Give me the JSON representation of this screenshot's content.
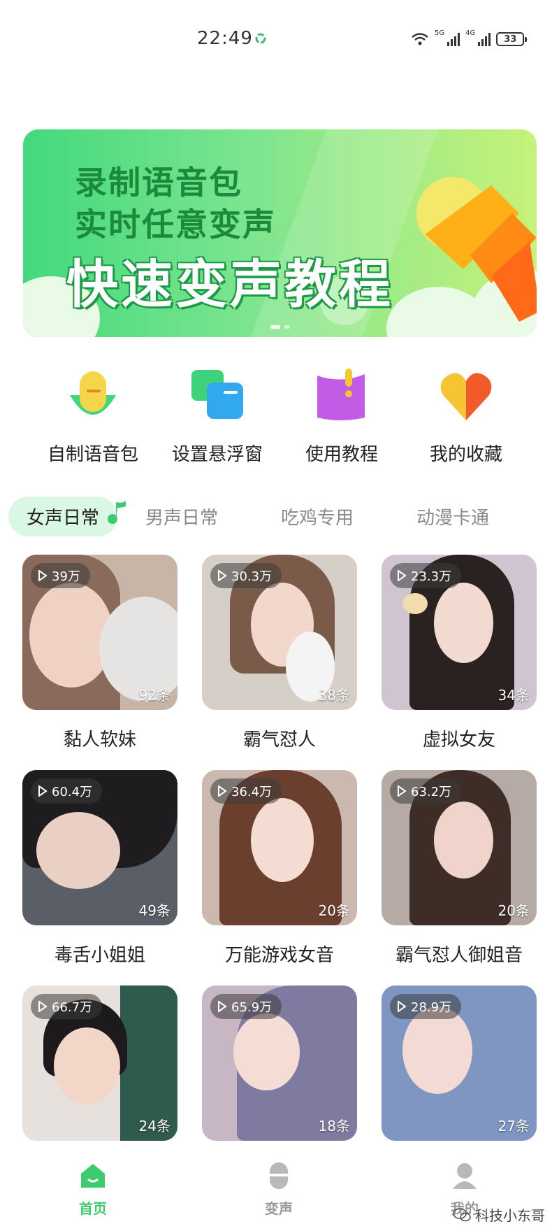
{
  "status_bar": {
    "time": "22:49",
    "network_1": "5G",
    "network_2": "4G",
    "battery": "33"
  },
  "banner": {
    "line1": "录制语音包",
    "line2": "实时任意变声",
    "line3": "快速变声教程",
    "pages": 2,
    "active_page": 1
  },
  "quick_actions": [
    {
      "label": "自制语音包",
      "icon": "mic-icon"
    },
    {
      "label": "设置悬浮窗",
      "icon": "window-icon"
    },
    {
      "label": "使用教程",
      "icon": "book-icon"
    },
    {
      "label": "我的收藏",
      "icon": "heart-icon"
    }
  ],
  "tabs": [
    {
      "label": "女声日常",
      "active": true
    },
    {
      "label": "男声日常",
      "active": false
    },
    {
      "label": "吃鸡专用",
      "active": false
    },
    {
      "label": "动漫卡通",
      "active": false
    }
  ],
  "cards": [
    {
      "plays": "39万",
      "count": "92条",
      "title": "黏人软妹"
    },
    {
      "plays": "30.3万",
      "count": "38条",
      "title": "霸气怼人"
    },
    {
      "plays": "23.3万",
      "count": "34条",
      "title": "虚拟女友"
    },
    {
      "plays": "60.4万",
      "count": "49条",
      "title": "毒舌小姐姐"
    },
    {
      "plays": "36.4万",
      "count": "20条",
      "title": "万能游戏女音"
    },
    {
      "plays": "63.2万",
      "count": "20条",
      "title": "霸气怼人御姐音"
    },
    {
      "plays": "66.7万",
      "count": "24条",
      "title": ""
    },
    {
      "plays": "65.9万",
      "count": "18条",
      "title": ""
    },
    {
      "plays": "28.9万",
      "count": "27条",
      "title": ""
    }
  ],
  "bottom_nav": [
    {
      "label": "首页",
      "icon": "home-icon",
      "active": true
    },
    {
      "label": "变声",
      "icon": "voice-change-icon",
      "active": false
    },
    {
      "label": "我的",
      "icon": "profile-icon",
      "active": false
    }
  ],
  "watermark": "科技小东哥",
  "colors": {
    "accent": "#3dcc6d",
    "tab_active_bg": "#d9f7e2"
  }
}
